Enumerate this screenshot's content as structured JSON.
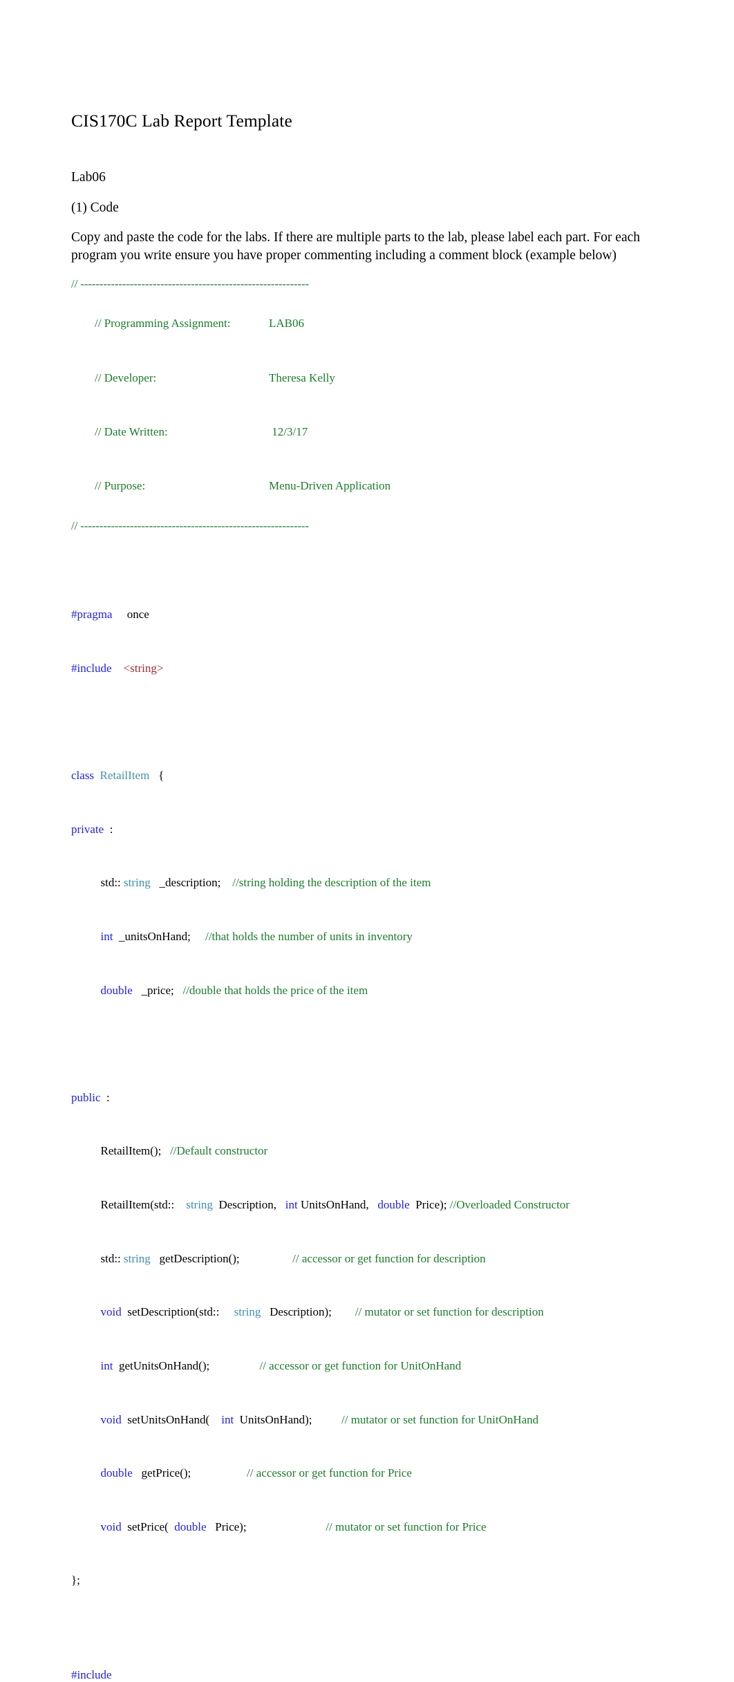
{
  "document": {
    "title": "CIS170C Lab Report Template",
    "lab_id": "Lab06",
    "section_label": "(1) Code",
    "instructions": "Copy and paste the code for the labs. If there are multiple parts to the lab, please label each part. For each program you write ensure you have proper commenting including a comment block (example below)"
  },
  "comment_header": {
    "rule_top": "// ------------------------------------------------------------",
    "rule_bottom": "// ------------------------------------------------------------",
    "rows": [
      {
        "key": "// Programming Assignment:",
        "value": "LAB06"
      },
      {
        "key": "// Developer:",
        "value": "Theresa Kelly"
      },
      {
        "key": "// Date Written:",
        "value": " 12/3/17"
      },
      {
        "key": "// Purpose:",
        "value": "Menu-Driven Application"
      }
    ]
  },
  "code": {
    "pragma_kw": "#pragma",
    "pragma_arg": "once",
    "include_kw": "#include",
    "include_arg": "<string>",
    "class_kw": "class",
    "class_name": "RetailItem",
    "class_brace": "{",
    "private_kw": "private",
    "private_colon": ":",
    "public_kw": "public",
    "public_colon": ":",
    "member_description": {
      "std": "std::",
      "type": "string",
      "name": "_description;",
      "comment": "//string holding the description of the item"
    },
    "member_units": {
      "type": "int",
      "name": "_unitsOnHand;",
      "comment": "//that holds the number of units in inventory"
    },
    "member_price": {
      "type": "double",
      "name": "_price;",
      "comment": "//double that holds the price of the item"
    },
    "ctor_default": {
      "sig": "RetailItem();",
      "comment": "//Default constructor"
    },
    "ctor_overload": {
      "part1": "RetailItem(std::",
      "type1": "string",
      "part2": "Description,",
      "type2": "int",
      "part3": "UnitsOnHand,",
      "type3": "double",
      "part4": "Price);",
      "comment": "//Overloaded Constructor"
    },
    "get_description": {
      "std": "std::",
      "type": "string",
      "sig": "getDescription();",
      "comment": "// accessor or get function for description"
    },
    "set_description": {
      "type": "void",
      "part1": "setDescription(std::",
      "type2": "string",
      "part2": "Description);",
      "comment": "// mutator or set function for description"
    },
    "get_units": {
      "type": "int",
      "sig": "getUnitsOnHand();",
      "comment": "// accessor or get function for UnitOnHand"
    },
    "set_units": {
      "type": "void",
      "part1": "setUnitsOnHand(",
      "type2": "int",
      "part2": "UnitsOnHand);",
      "comment": "// mutator or set function for UnitOnHand"
    },
    "get_price": {
      "type": "double",
      "sig": "getPrice();",
      "comment": "// accessor or get function for Price"
    },
    "set_price": {
      "type": "void",
      "part1": "setPrice(",
      "type2": "double",
      "part2": "Price);",
      "comment": "// mutator or set function for Price"
    },
    "class_end": "};",
    "tail_include": "#include"
  },
  "colors": {
    "keyword_blue": "#2222dd",
    "type_teal": "#3d8fae",
    "class_teal": "#4a90a8",
    "string_red": "#a03030",
    "comment_green": "#1e7b2e",
    "text_black": "#000000",
    "page_background": "#ffffff"
  }
}
